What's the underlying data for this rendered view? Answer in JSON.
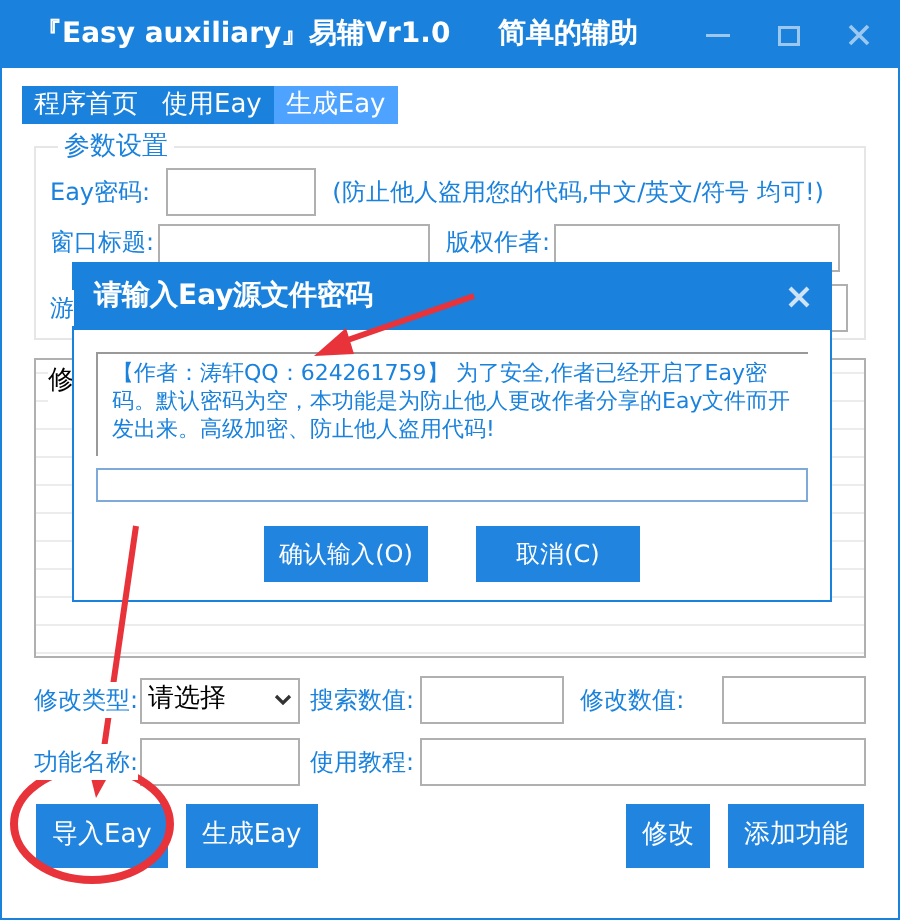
{
  "window": {
    "title": "『Easy auxiliary』易辅Vr1.0",
    "subtitle": "简单的辅助"
  },
  "tabs": [
    {
      "label": "程序首页",
      "selected": false
    },
    {
      "label": "使用Eay",
      "selected": false
    },
    {
      "label": "生成Eay",
      "selected": true
    }
  ],
  "params": {
    "title": "参数设置",
    "password_label": "Eay密码:",
    "password_hint": "(防止他人盗用您的代码,中文/英文/符号 均可!)",
    "window_title_label": "窗口标题:",
    "author_label": "版权作者:",
    "row3_label": "游"
  },
  "table": {
    "header": "修"
  },
  "form": {
    "type_label": "修改类型:",
    "type_value": "请选择",
    "search_label": "搜索数值:",
    "modify_label": "修改数值:",
    "name_label": "功能名称:",
    "tutorial_label": "使用教程:"
  },
  "buttons": [
    "导入Eay",
    "生成Eay",
    "修改",
    "添加功能"
  ],
  "dialog": {
    "title": "请输入Eay源文件密码",
    "message": "【作者：涛轩QQ：624261759】 为了安全,作者已经开启了Eay密码。默认密码为空，本功能是为防止他人更改作者分享的Eay文件而开发出来。高级加密、防止他人盗用代码!",
    "buttons": [
      "确认输入(O)",
      "取消(C)"
    ]
  }
}
